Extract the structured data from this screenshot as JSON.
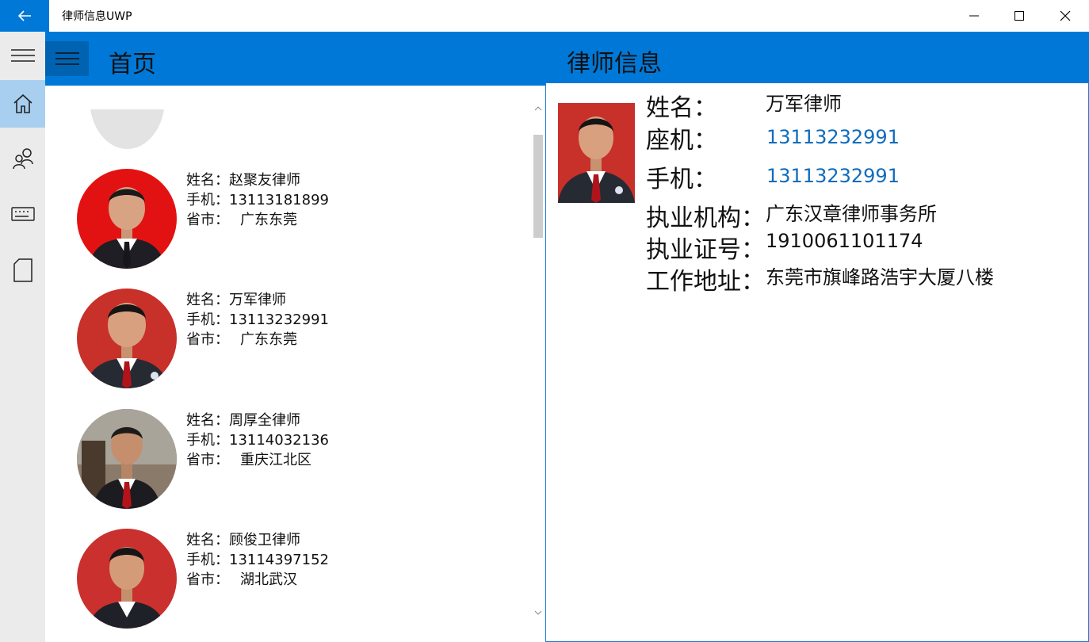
{
  "window": {
    "title": "律师信息UWP",
    "accent_color": "#0078d7",
    "minimize_icon": "minimize-icon",
    "maximize_icon": "maximize-icon",
    "close_icon": "close-icon"
  },
  "nav": {
    "items": [
      {
        "icon": "hamburger-icon"
      },
      {
        "icon": "home-icon",
        "selected": true
      },
      {
        "icon": "people-icon"
      },
      {
        "icon": "keyboard-icon"
      },
      {
        "icon": "page-icon"
      }
    ]
  },
  "header": {
    "title": "首页",
    "detail_title": "律师信息"
  },
  "list": {
    "name_label": "姓名：",
    "phone_label": "手机：",
    "region_label": "省市：",
    "items": [
      {
        "name": "赵聚友律师",
        "phone": "13113181899",
        "region": "广东东莞"
      },
      {
        "name": "万军律师",
        "phone": "13113232991",
        "region": "广东东莞"
      },
      {
        "name": "周厚全律师",
        "phone": "13114032136",
        "region": "重庆江北区"
      },
      {
        "name": "顾俊卫律师",
        "phone": "13114397152",
        "region": "湖北武汉"
      }
    ]
  },
  "detail": {
    "name_label": "姓名：",
    "name": "万军律师",
    "landline_label": "座机：",
    "landline": "13113232991",
    "mobile_label": "手机：",
    "mobile": "13113232991",
    "firm_label": "执业机构：",
    "firm": "广东汉章律师事务所",
    "license_label": "执业证号：",
    "license": "1910061101174",
    "address_label": "工作地址：",
    "address": "东莞市旗峰路浩宇大厦八楼"
  }
}
